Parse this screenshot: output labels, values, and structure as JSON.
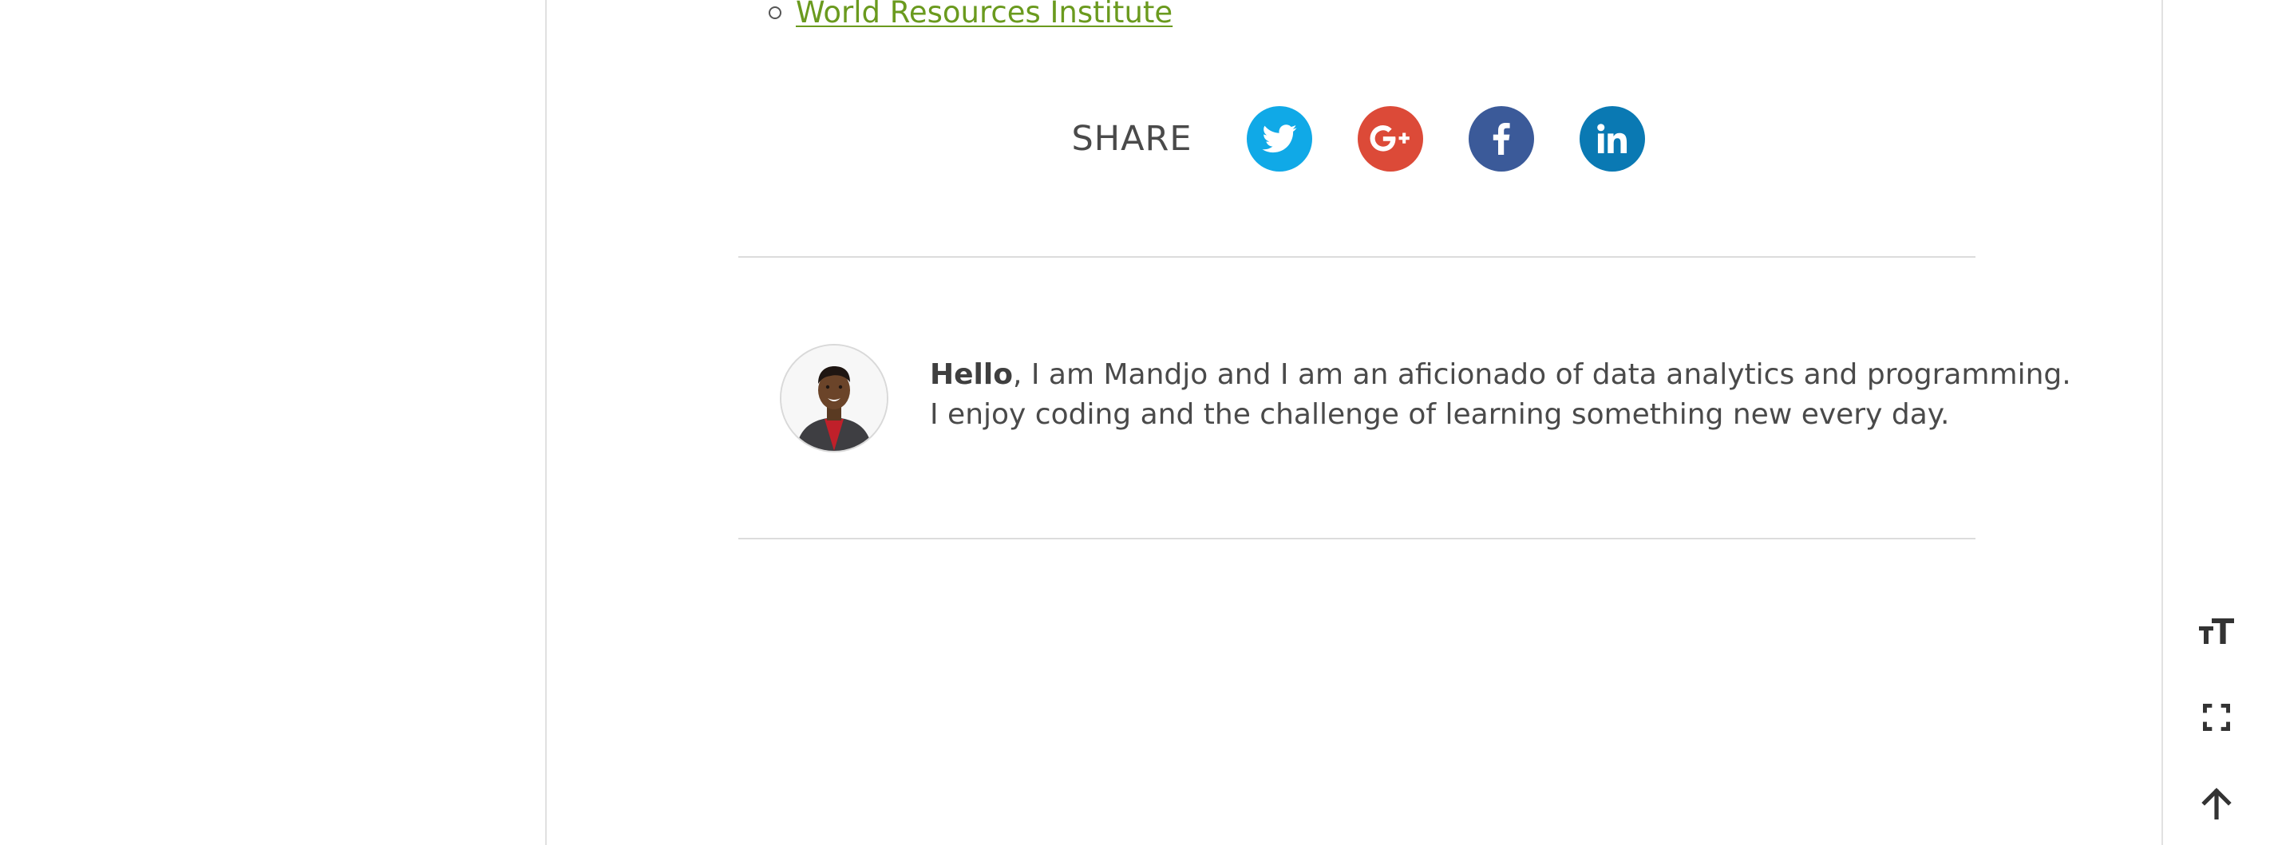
{
  "references": [
    {
      "label": "World Resources Institute"
    }
  ],
  "share": {
    "label": "SHARE",
    "buttons": [
      {
        "network": "twitter",
        "icon": "twitter-icon",
        "color": "#10a9e7"
      },
      {
        "network": "google-plus",
        "icon": "google-plus-icon",
        "color": "#dc4a38"
      },
      {
        "network": "facebook",
        "icon": "facebook-icon",
        "color": "#3b5a99"
      },
      {
        "network": "linkedin",
        "icon": "linkedin-icon",
        "color": "#0a79b3"
      }
    ]
  },
  "author": {
    "greeting": "Hello",
    "line1_rest": ", I am Mandjo and I am an aficionado of data analytics and programming.",
    "line2": "I enjoy coding and the challenge of learning something new every day."
  },
  "tools": [
    {
      "icon": "text-size-icon"
    },
    {
      "icon": "fullscreen-icon"
    },
    {
      "icon": "arrow-up-icon"
    }
  ],
  "colors": {
    "link": "#6a9a1e",
    "text": "#4a4a4a",
    "divider": "#dcdcdc"
  }
}
